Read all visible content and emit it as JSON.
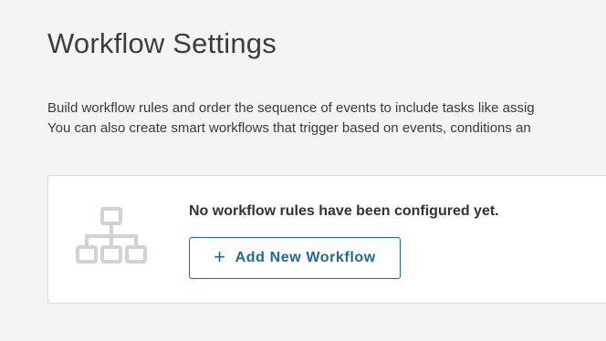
{
  "header": {
    "title": "Workflow Settings"
  },
  "description": {
    "line1": "Build workflow rules and order the sequence of events to include tasks like assig",
    "line2": "You can also create smart workflows that trigger based on events, conditions an"
  },
  "empty_state": {
    "icon": "workflow-hierarchy-icon",
    "message": "No workflow rules have been configured yet.",
    "add_button_label": "Add New Workflow",
    "add_button_icon": "plus-icon",
    "add_button_symbol": "+"
  },
  "colors": {
    "background": "#f4f4f4",
    "accent": "#1b6a98",
    "icon_gray": "#d2d2d2"
  }
}
